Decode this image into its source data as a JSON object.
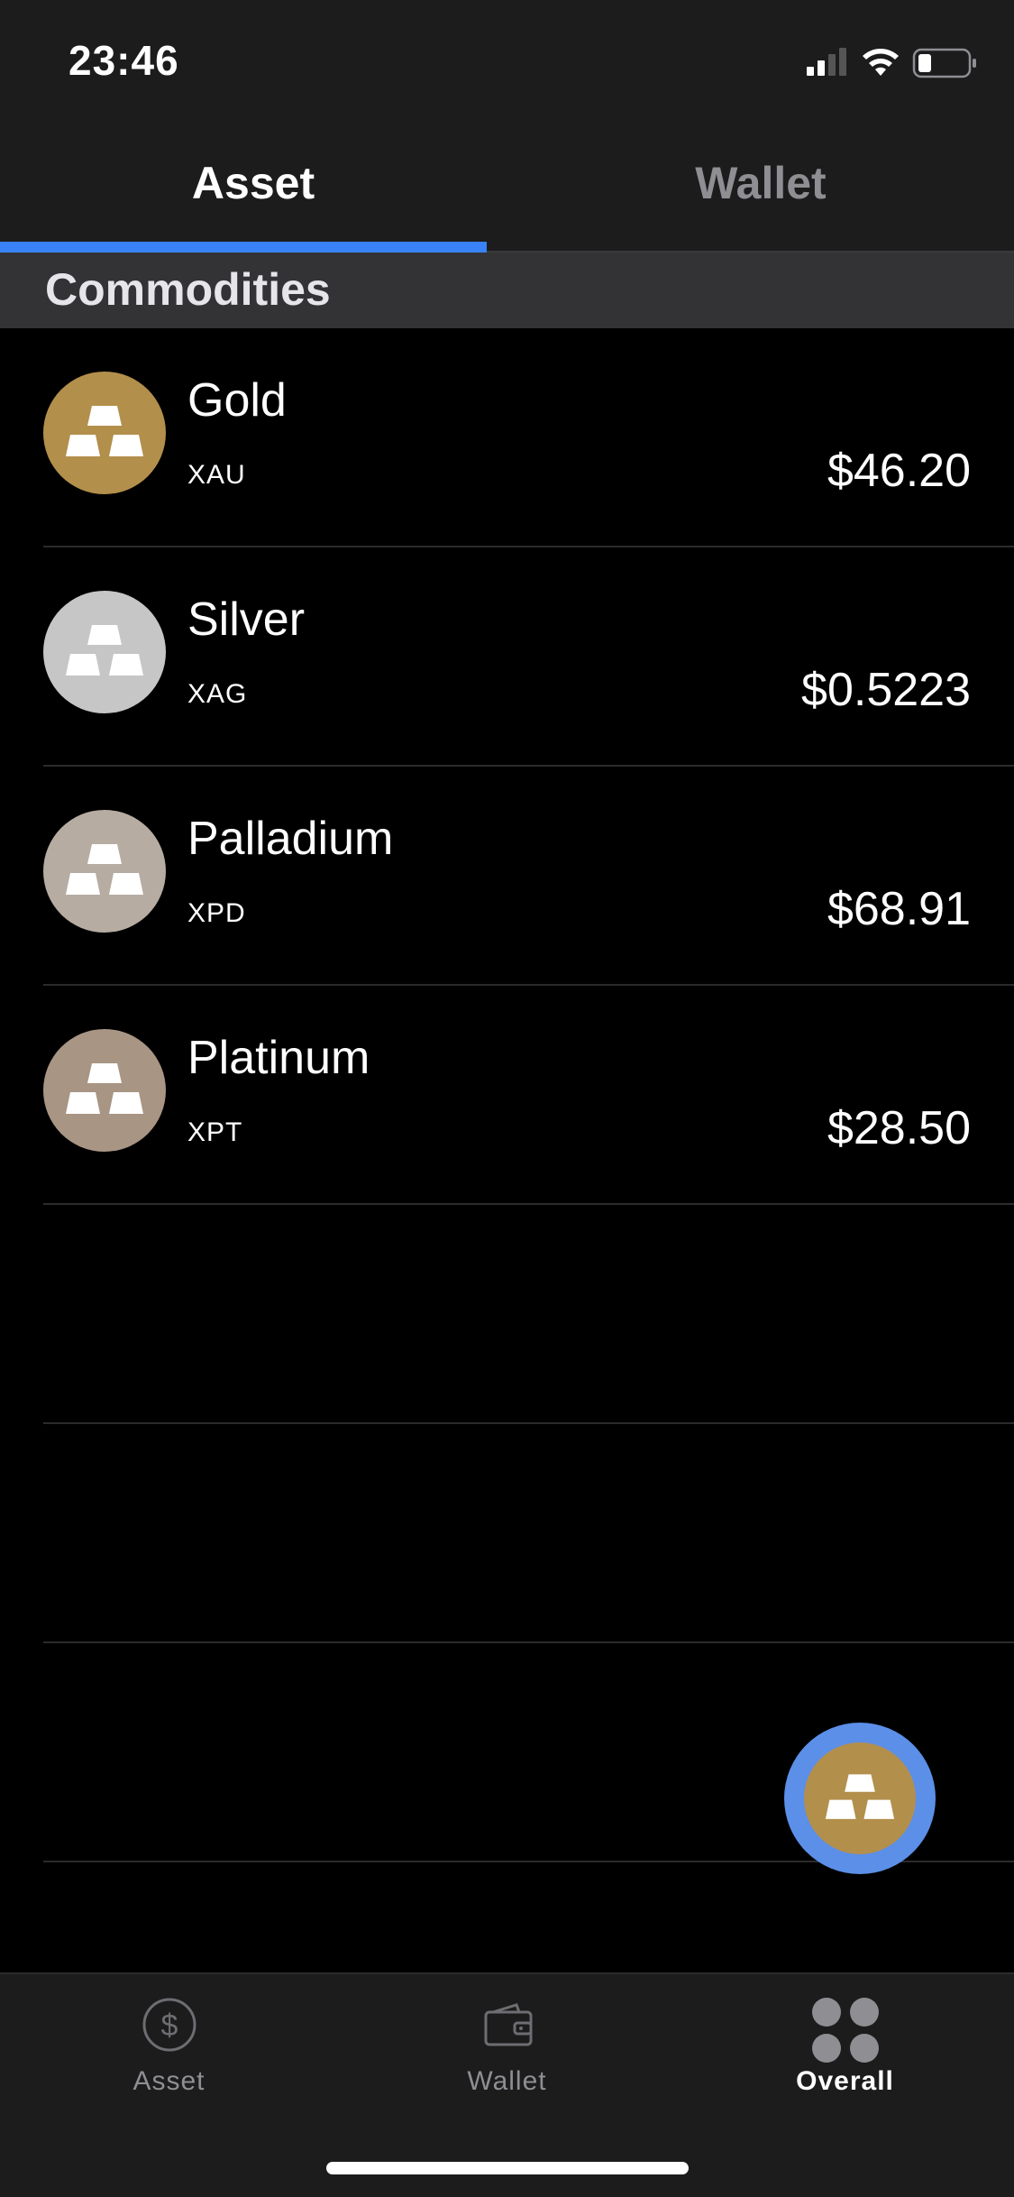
{
  "status": {
    "time": "23:46"
  },
  "top_tabs": [
    {
      "label": "Asset",
      "active": true
    },
    {
      "label": "Wallet",
      "active": false
    }
  ],
  "section": {
    "title": "Commodities"
  },
  "assets": [
    {
      "name": "Gold",
      "symbol": "XAU",
      "price": "$46.20",
      "color": "#b38f4c"
    },
    {
      "name": "Silver",
      "symbol": "XAG",
      "price": "$0.5223",
      "color": "#c6c6c6"
    },
    {
      "name": "Palladium",
      "symbol": "XPD",
      "price": "$68.91",
      "color": "#b6aca2"
    },
    {
      "name": "Platinum",
      "symbol": "XPT",
      "price": "$28.50",
      "color": "#a89584"
    }
  ],
  "bottom_tabs": [
    {
      "label": "Asset",
      "icon": "dollar-circle-icon",
      "active": false
    },
    {
      "label": "Wallet",
      "icon": "wallet-icon",
      "active": false
    },
    {
      "label": "Overall",
      "icon": "grid-dots-icon",
      "active": true
    }
  ],
  "colors": {
    "accent": "#3a82f7",
    "fab_ring": "#5b8fe8",
    "fab_inner": "#b38f4c"
  }
}
